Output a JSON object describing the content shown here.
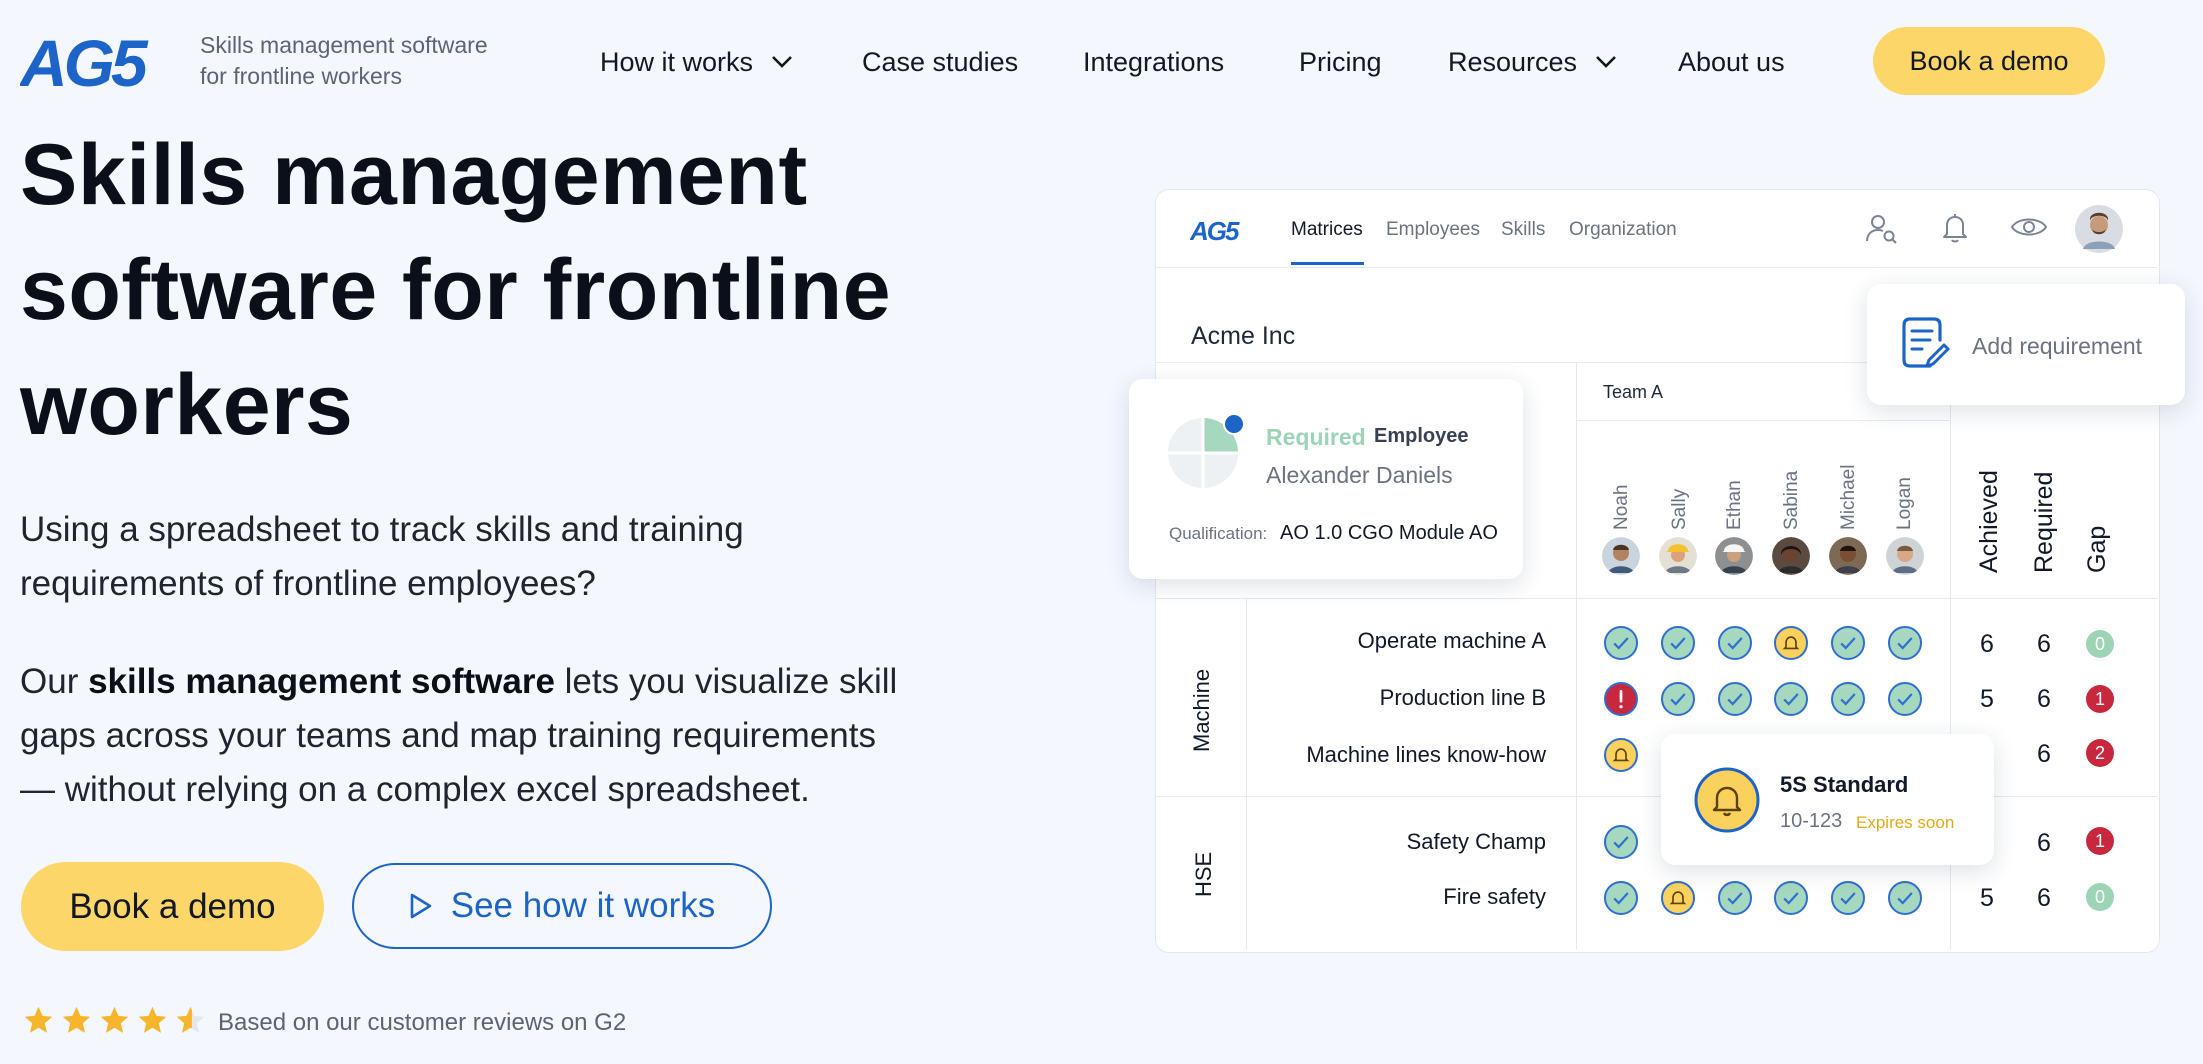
{
  "header": {
    "logo_text": "AG5",
    "tagline_line1": "Skills management software",
    "tagline_line2": "for frontline workers",
    "nav": [
      {
        "label": "How it works",
        "has_dropdown": true
      },
      {
        "label": "Case studies",
        "has_dropdown": false
      },
      {
        "label": "Integrations",
        "has_dropdown": false
      },
      {
        "label": "Pricing",
        "has_dropdown": false
      },
      {
        "label": "Resources",
        "has_dropdown": true
      },
      {
        "label": "About us",
        "has_dropdown": false
      }
    ],
    "cta_label": "Book a demo"
  },
  "hero": {
    "title_line1": "Skills management",
    "title_line2": "software for frontline",
    "title_line3": "workers",
    "intro_line1": "Using a spreadsheet to track skills and training",
    "intro_line2": "requirements of frontline employees?",
    "body_prefix": "Our ",
    "body_bold": "skills management software",
    "body_line1_suffix": " lets you visualize skill",
    "body_line2": "gaps across your teams and map training requirements",
    "body_line3": "— without relying on a complex excel spreadsheet.",
    "primary_button": "Book a demo",
    "secondary_button": "See how it works",
    "rating_stars": 4.5,
    "rating_text": "Based on our customer reviews on G2"
  },
  "app": {
    "logo_text": "AG5",
    "tabs": [
      "Matrices",
      "Employees",
      "Skills",
      "Organization"
    ],
    "active_tab": "Matrices",
    "company": "Acme Inc",
    "team": "Team A",
    "employees": [
      "Noah",
      "Sally",
      "Ethan",
      "Sabina",
      "Michael",
      "Logan"
    ],
    "stat_headers": [
      "Achieved",
      "Required",
      "Gap"
    ],
    "groups": [
      {
        "name": "Machine",
        "skills": [
          {
            "name": "Operate machine A",
            "cells": [
              "ok",
              "ok",
              "ok",
              "warn",
              "ok",
              "ok"
            ],
            "achieved": "6",
            "required": "6",
            "gap": "0"
          },
          {
            "name": "Production line B",
            "cells": [
              "bad",
              "ok",
              "ok",
              "ok",
              "ok",
              "ok"
            ],
            "achieved": "5",
            "required": "6",
            "gap": "1"
          },
          {
            "name": "Machine lines know-how",
            "cells": [
              "warn",
              "",
              "",
              "",
              "",
              ""
            ],
            "achieved": "",
            "required": "6",
            "gap": "2"
          }
        ]
      },
      {
        "name": "HSE",
        "skills": [
          {
            "name": "Safety Champ",
            "cells": [
              "ok",
              "",
              "",
              "",
              "",
              ""
            ],
            "achieved": "",
            "required": "6",
            "gap": "1"
          },
          {
            "name": "Fire safety",
            "cells": [
              "ok",
              "warn",
              "ok",
              "ok",
              "ok",
              "ok"
            ],
            "achieved": "5",
            "required": "6",
            "gap": "0"
          }
        ]
      }
    ],
    "popup_requirement": {
      "status": "Required",
      "type": "Employee",
      "name": "Alexander Daniels",
      "qualification_label": "Qualification:",
      "qualification_value": "AO 1.0 CGO Module AO"
    },
    "popup_add": {
      "label": "Add requirement"
    },
    "popup_standard": {
      "title": "5S Standard",
      "code": "10-123",
      "status": "Expires soon"
    }
  },
  "colors": {
    "background": "#f4f7fd",
    "brand_blue": "#1d64c9",
    "cta_yellow": "#fdd669",
    "ok_green": "#a6d8bf",
    "warn_yellow": "#fbd15e",
    "alert_red": "#c8283d"
  },
  "icons": [
    "chevron-down-icon",
    "play-icon",
    "star-icon",
    "user-search-icon",
    "bell-icon",
    "eye-icon",
    "document-edit-icon",
    "check-icon",
    "exclamation-icon"
  ]
}
